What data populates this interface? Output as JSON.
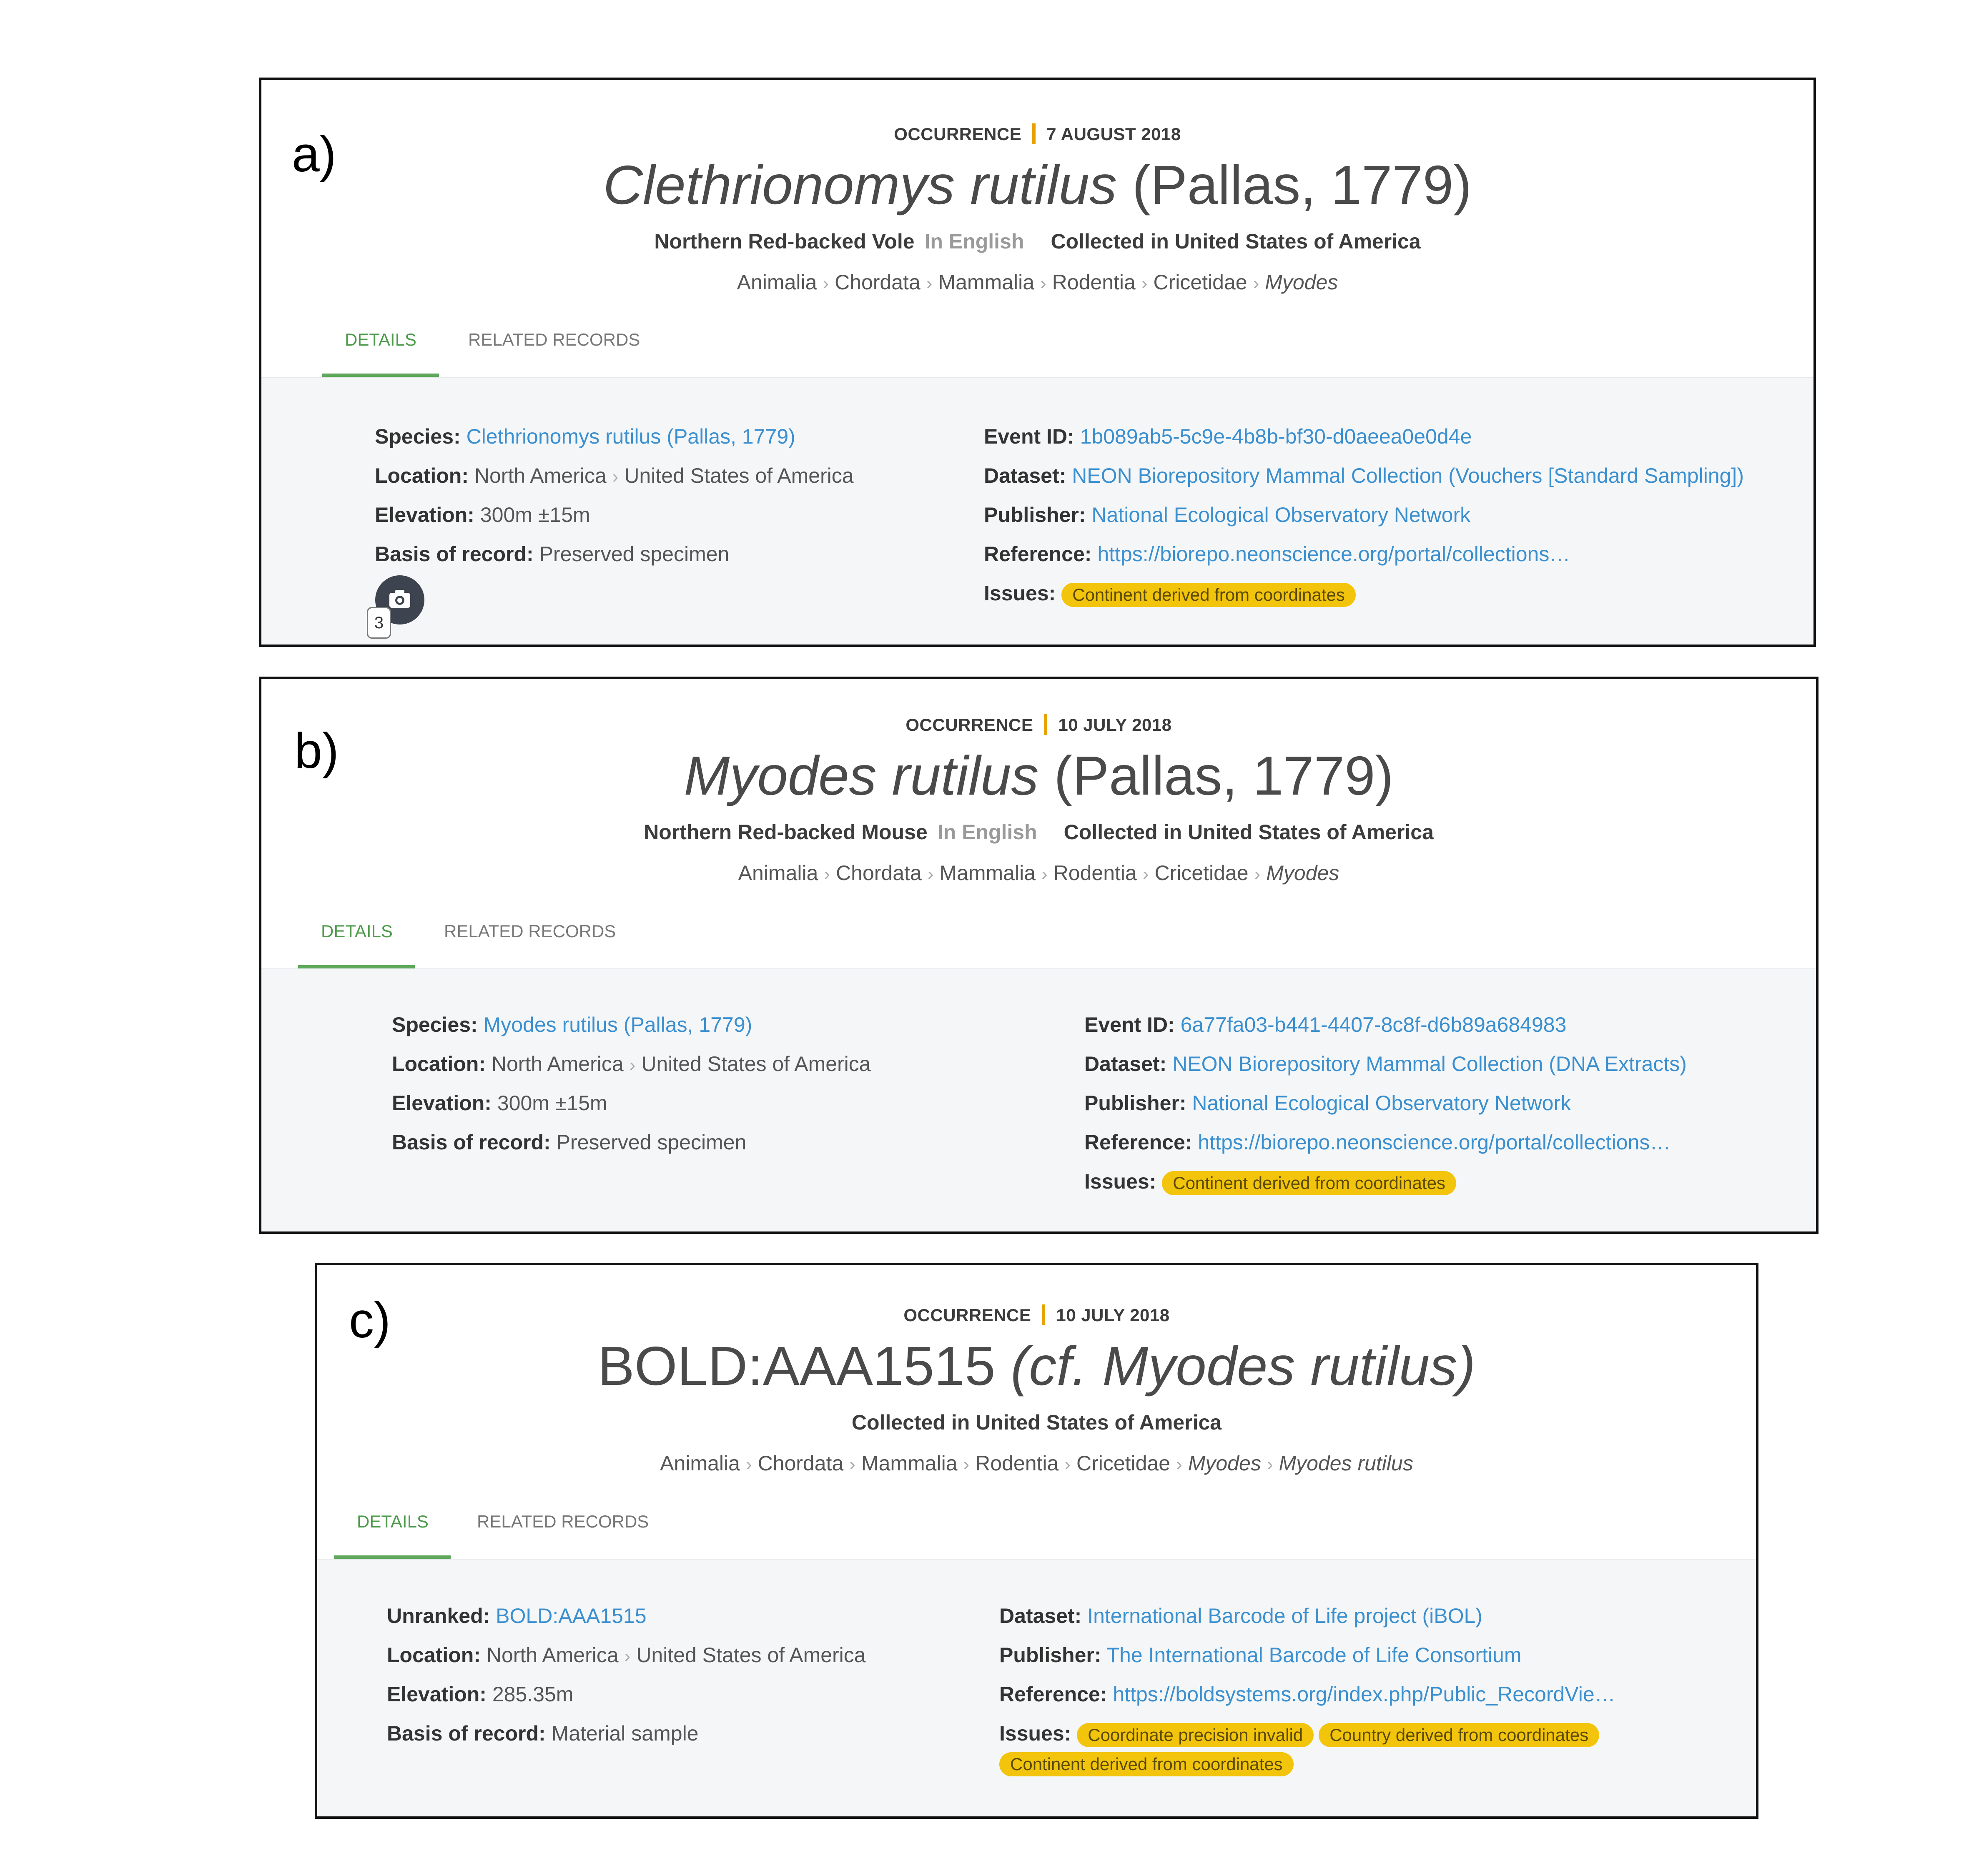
{
  "panels": {
    "a": {
      "letter": "a)",
      "kind": "OCCURRENCE",
      "date": "7 AUGUST 2018",
      "title_italic": "Clethrionomys rutilus",
      "title_plain": "(Pallas, 1779)",
      "common_name": "Northern Red-backed Vole",
      "language": "In English",
      "collected": "Collected in United States of America",
      "crumbs": [
        "Animalia",
        "Chordata",
        "Mammalia",
        "Rodentia",
        "Cricetidae"
      ],
      "crumb_italic": "Myodes",
      "tabs": [
        "DETAILS",
        "RELATED RECORDS"
      ],
      "left": {
        "species_label": "Species:",
        "species": "Clethrionomys rutilus (Pallas, 1779)",
        "location_label": "Location:",
        "location_1": "North America",
        "location_2": "United States of America",
        "elevation_label": "Elevation:",
        "elevation": "300m ±15m",
        "basis_label": "Basis of record:",
        "basis": "Preserved specimen"
      },
      "right": {
        "event_label": "Event ID:",
        "event": "1b089ab5-5c9e-4b8b-bf30-d0aeea0e0d4e",
        "dataset_label": "Dataset:",
        "dataset": "NEON Biorepository Mammal Collection (Vouchers [Standard Sampling])",
        "publisher_label": "Publisher:",
        "publisher": "National Ecological Observatory Network",
        "reference_label": "Reference:",
        "reference": "https://biorepo.neonscience.org/portal/collections…",
        "issues_label": "Issues:",
        "issues": [
          "Continent derived from coordinates"
        ]
      },
      "media_count": "3"
    },
    "b": {
      "letter": "b)",
      "kind": "OCCURRENCE",
      "date": "10 JULY 2018",
      "title_italic": "Myodes rutilus",
      "title_plain": "(Pallas, 1779)",
      "common_name": "Northern Red-backed Mouse",
      "language": "In English",
      "collected": "Collected in United States of America",
      "crumbs": [
        "Animalia",
        "Chordata",
        "Mammalia",
        "Rodentia",
        "Cricetidae"
      ],
      "crumb_italic": "Myodes",
      "tabs": [
        "DETAILS",
        "RELATED RECORDS"
      ],
      "left": {
        "species_label": "Species:",
        "species": "Myodes rutilus (Pallas, 1779)",
        "location_label": "Location:",
        "location_1": "North America",
        "location_2": "United States of America",
        "elevation_label": "Elevation:",
        "elevation": "300m ±15m",
        "basis_label": "Basis of record:",
        "basis": "Preserved specimen"
      },
      "right": {
        "event_label": "Event ID:",
        "event": "6a77fa03-b441-4407-8c8f-d6b89a684983",
        "dataset_label": "Dataset:",
        "dataset": "NEON Biorepository Mammal Collection (DNA Extracts)",
        "publisher_label": "Publisher:",
        "publisher": "National Ecological Observatory Network",
        "reference_label": "Reference:",
        "reference": "https://biorepo.neonscience.org/portal/collections…",
        "issues_label": "Issues:",
        "issues": [
          "Continent derived from coordinates"
        ]
      }
    },
    "c": {
      "letter": "c)",
      "kind": "OCCURRENCE",
      "date": "10 JULY 2018",
      "title_plain": "BOLD:AAA1515",
      "title_italic": "(cf. Myodes rutilus)",
      "collected": "Collected in United States of America",
      "crumbs": [
        "Animalia",
        "Chordata",
        "Mammalia",
        "Rodentia",
        "Cricetidae"
      ],
      "crumb_italic": "Myodes",
      "crumb_italic_2": "Myodes rutilus",
      "tabs": [
        "DETAILS",
        "RELATED RECORDS"
      ],
      "left": {
        "unranked_label": "Unranked:",
        "unranked": "BOLD:AAA1515",
        "location_label": "Location:",
        "location_1": "North America",
        "location_2": "United States of America",
        "elevation_label": "Elevation:",
        "elevation": "285.35m",
        "basis_label": "Basis of record:",
        "basis": "Material sample"
      },
      "right": {
        "dataset_label": "Dataset:",
        "dataset": "International Barcode of Life project (iBOL)",
        "publisher_label": "Publisher:",
        "publisher": "The International Barcode of Life Consortium",
        "reference_label": "Reference:",
        "reference": "https://boldsystems.org/index.php/Public_RecordVie…",
        "issues_label": "Issues:",
        "issues": [
          "Coordinate precision invalid",
          "Country derived from coordinates",
          "Continent derived from coordinates"
        ]
      }
    }
  },
  "colors": {
    "link": "#3a8fcf",
    "tab_active": "#4c9a4a",
    "issue_chip": "#f2c40c",
    "separator": "#e8a200",
    "details_bg": "#f5f6f8"
  }
}
